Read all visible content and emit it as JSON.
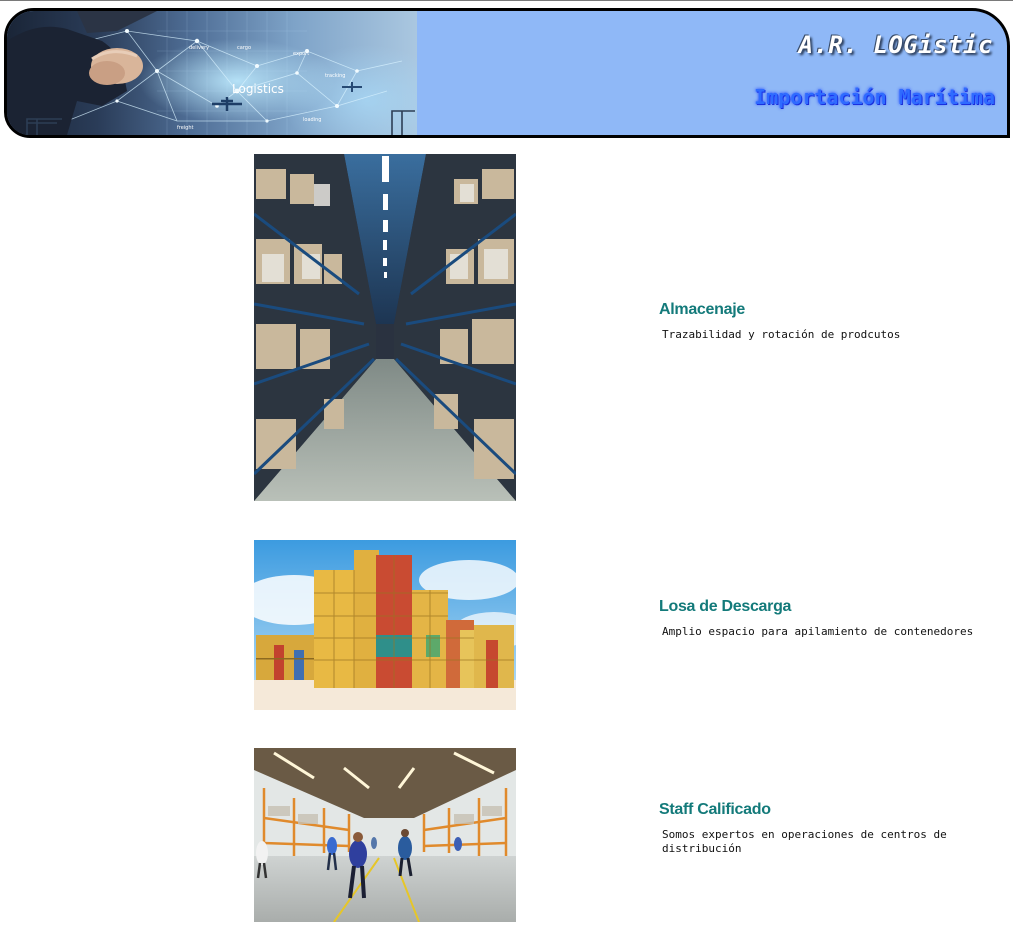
{
  "header": {
    "brand": "A.R. LOGistic",
    "subtitle": "Importación Marítima",
    "banner_words": {
      "logistics": "Logistics",
      "delivery": "delivery",
      "cargo": "cargo",
      "tracking": "tracking",
      "freight": "freight",
      "loading": "loading",
      "export": "export"
    }
  },
  "services": [
    {
      "title": "Almacenaje",
      "description": "Trazabilidad y rotación de prodcutos",
      "image": "warehouse-aisle"
    },
    {
      "title": "Losa de Descarga",
      "description": "Amplio espacio para apilamiento de contenedores",
      "image": "stacked-containers"
    },
    {
      "title": "Staff Calificado",
      "description": "Somos expertos en operaciones de centros de distribución",
      "image": "warehouse-staff"
    }
  ],
  "colors": {
    "header_bg": "#8fb8f7",
    "title_teal": "#137a7a",
    "subtitle_blue": "#2f6bff"
  }
}
